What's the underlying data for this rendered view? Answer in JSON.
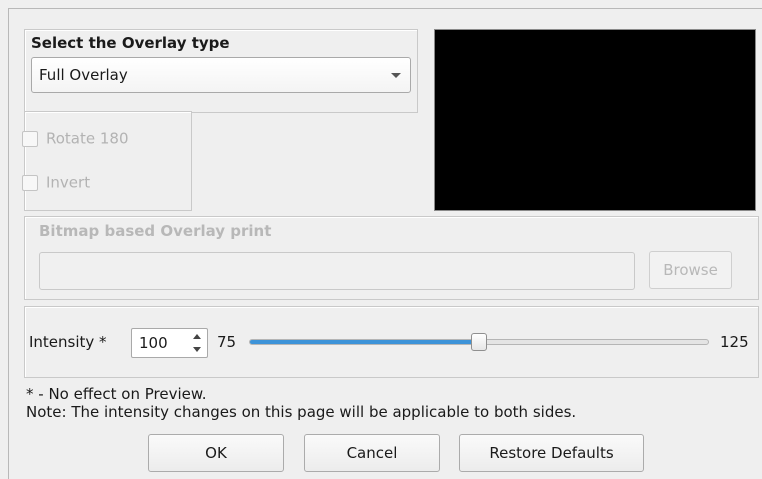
{
  "overlay": {
    "group_title": "Select the Overlay type",
    "selected_type": "Full Overlay"
  },
  "options": {
    "rotate_label": "Rotate 180",
    "rotate_checked": false,
    "invert_label": "Invert",
    "invert_checked": false
  },
  "bitmap": {
    "title": "Bitmap based Overlay print",
    "path_value": "",
    "browse_label": "Browse"
  },
  "intensity": {
    "label": "Intensity *",
    "value": "100",
    "min_label": "75",
    "max_label": "125",
    "min": 75,
    "max": 125,
    "current": 100
  },
  "notes": {
    "line1": "* - No effect on Preview.",
    "line2": "Note: The intensity changes on this page will be applicable to both sides."
  },
  "buttons": {
    "ok": "OK",
    "cancel": "Cancel",
    "restore": "Restore Defaults"
  },
  "colors": {
    "slider_fill": "#3d93d8",
    "preview_background": "#000000",
    "disabled_text": "#b3b3b3"
  }
}
